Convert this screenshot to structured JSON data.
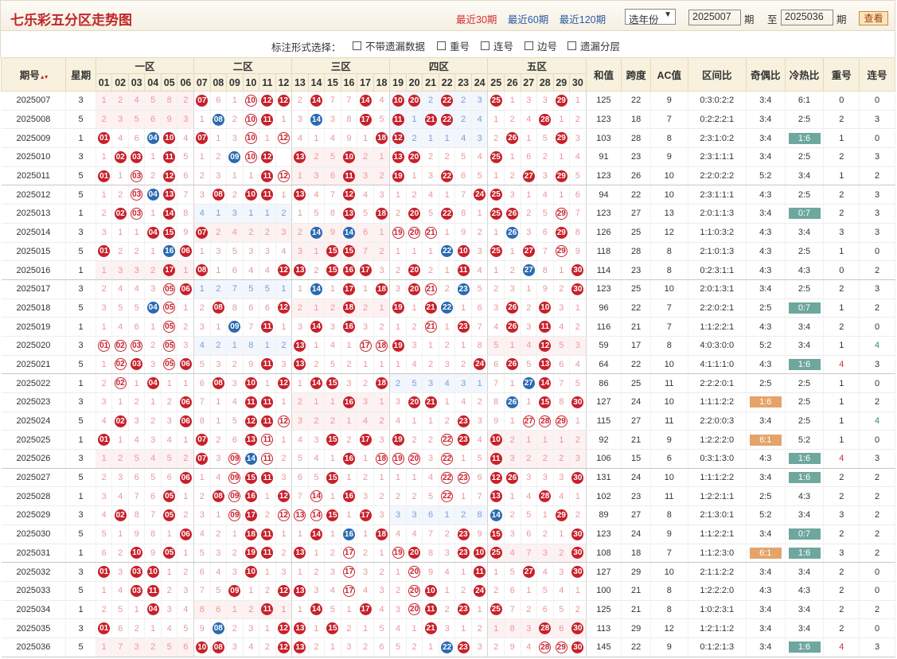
{
  "header": {
    "title": "七乐彩五分区走势图",
    "links": [
      "最近30期",
      "最近60期",
      "最近120期"
    ],
    "active_link": 0,
    "year_select": "选年份",
    "from_value": "2025007",
    "to_value": "2025036",
    "label_qi": "期",
    "label_to": "至",
    "view_button": "查看"
  },
  "options": {
    "label": "标注形式选择：",
    "items": [
      "不带遗漏数据",
      "重号",
      "连号",
      "边号",
      "遗漏分层"
    ]
  },
  "table": {
    "columns": {
      "period": "期号",
      "sort_icon": "sort-arrows-icon",
      "week": "星期",
      "zones": [
        "一区",
        "二区",
        "三区",
        "四区",
        "五区"
      ],
      "numbers": [
        "01",
        "02",
        "03",
        "04",
        "05",
        "06",
        "07",
        "08",
        "09",
        "10",
        "11",
        "12",
        "13",
        "14",
        "15",
        "16",
        "17",
        "18",
        "19",
        "20",
        "21",
        "22",
        "23",
        "24",
        "25",
        "26",
        "27",
        "28",
        "29",
        "30"
      ],
      "sum": "和值",
      "span": "跨度",
      "ac": "AC值",
      "zone_ratio": "区间比",
      "odd_even": "奇偶比",
      "hot_cold": "冷热比",
      "repeat": "重号",
      "consecutive": "连号"
    },
    "rows": [
      {
        "period": "2025007",
        "week": "3",
        "sum": "125",
        "span": "22",
        "ac": "9",
        "zone": "0:3:0:2:2",
        "oe": "3:4",
        "hc": "6:1",
        "rep": "0",
        "con": "0"
      },
      {
        "period": "2025008",
        "week": "5",
        "sum": "123",
        "span": "18",
        "ac": "7",
        "zone": "0:2:2:2:1",
        "oe": "3:4",
        "hc": "2:5",
        "rep": "2",
        "con": "3"
      },
      {
        "period": "2025009",
        "week": "1",
        "sum": "103",
        "span": "28",
        "ac": "8",
        "zone": "2:3:1:0:2",
        "oe": "3:4",
        "hc": "1:6",
        "rep": "1",
        "con": "0"
      },
      {
        "period": "2025010",
        "week": "3",
        "sum": "91",
        "span": "23",
        "ac": "9",
        "zone": "2:3:1:1:1",
        "oe": "3:4",
        "hc": "2:5",
        "rep": "2",
        "con": "3"
      },
      {
        "period": "2025011",
        "week": "5",
        "sum": "123",
        "span": "26",
        "ac": "10",
        "zone": "2:2:0:2:2",
        "oe": "5:2",
        "hc": "3:4",
        "rep": "1",
        "con": "2"
      },
      {
        "period": "2025012",
        "week": "5",
        "sum": "94",
        "span": "22",
        "ac": "10",
        "zone": "2:3:1:1:1",
        "oe": "4:3",
        "hc": "2:5",
        "rep": "2",
        "con": "3"
      },
      {
        "period": "2025013",
        "week": "1",
        "sum": "123",
        "span": "27",
        "ac": "13",
        "zone": "2:0:1:1:3",
        "oe": "3:4",
        "hc": "0:7",
        "rep": "2",
        "con": "3"
      },
      {
        "period": "2025014",
        "week": "3",
        "sum": "126",
        "span": "25",
        "ac": "12",
        "zone": "1:1:0:3:2",
        "oe": "4:3",
        "hc": "3:4",
        "rep": "3",
        "con": "3"
      },
      {
        "period": "2025015",
        "week": "5",
        "sum": "118",
        "span": "28",
        "ac": "8",
        "zone": "2:1:0:1:3",
        "oe": "4:3",
        "hc": "2:5",
        "rep": "1",
        "con": "0"
      },
      {
        "period": "2025016",
        "week": "1",
        "sum": "114",
        "span": "23",
        "ac": "8",
        "zone": "0:2:3:1:1",
        "oe": "4:3",
        "hc": "4:3",
        "rep": "0",
        "con": "2"
      },
      {
        "period": "2025017",
        "week": "3",
        "sum": "123",
        "span": "25",
        "ac": "10",
        "zone": "2:0:1:3:1",
        "oe": "3:4",
        "hc": "2:5",
        "rep": "2",
        "con": "3"
      },
      {
        "period": "2025018",
        "week": "5",
        "sum": "96",
        "span": "22",
        "ac": "7",
        "zone": "2:2:0:2:1",
        "oe": "2:5",
        "hc": "0:7",
        "rep": "1",
        "con": "2"
      },
      {
        "period": "2025019",
        "week": "1",
        "sum": "116",
        "span": "21",
        "ac": "7",
        "zone": "1:1:2:2:1",
        "oe": "4:3",
        "hc": "3:4",
        "rep": "2",
        "con": "0"
      },
      {
        "period": "2025020",
        "week": "3",
        "sum": "59",
        "span": "17",
        "ac": "8",
        "zone": "4:0:3:0:0",
        "oe": "5:2",
        "hc": "3:4",
        "rep": "1",
        "con": "4"
      },
      {
        "period": "2025021",
        "week": "5",
        "sum": "64",
        "span": "22",
        "ac": "10",
        "zone": "4:1:1:1:0",
        "oe": "4:3",
        "hc": "1:6",
        "rep": "4",
        "con": "3"
      },
      {
        "period": "2025022",
        "week": "1",
        "sum": "86",
        "span": "25",
        "ac": "11",
        "zone": "2:2:2:0:1",
        "oe": "2:5",
        "hc": "2:5",
        "rep": "1",
        "con": "0"
      },
      {
        "period": "2025023",
        "week": "3",
        "sum": "127",
        "span": "24",
        "ac": "10",
        "zone": "1:1:1:2:2",
        "oe": "1:6",
        "hc": "2:5",
        "rep": "1",
        "con": "2"
      },
      {
        "period": "2025024",
        "week": "5",
        "sum": "115",
        "span": "27",
        "ac": "11",
        "zone": "2:2:0:0:3",
        "oe": "3:4",
        "hc": "2:5",
        "rep": "1",
        "con": "4"
      },
      {
        "period": "2025025",
        "week": "1",
        "sum": "92",
        "span": "21",
        "ac": "9",
        "zone": "1:2:2:2:0",
        "oe": "6:1",
        "hc": "5:2",
        "rep": "1",
        "con": "0"
      },
      {
        "period": "2025026",
        "week": "3",
        "sum": "106",
        "span": "15",
        "ac": "6",
        "zone": "0:3:1:3:0",
        "oe": "4:3",
        "hc": "1:6",
        "rep": "4",
        "con": "3"
      },
      {
        "period": "2025027",
        "week": "5",
        "sum": "131",
        "span": "24",
        "ac": "10",
        "zone": "1:1:1:2:2",
        "oe": "3:4",
        "hc": "1:6",
        "rep": "2",
        "con": "2"
      },
      {
        "period": "2025028",
        "week": "1",
        "sum": "102",
        "span": "23",
        "ac": "11",
        "zone": "1:2:2:1:1",
        "oe": "2:5",
        "hc": "4:3",
        "rep": "2",
        "con": "2"
      },
      {
        "period": "2025029",
        "week": "3",
        "sum": "89",
        "span": "27",
        "ac": "8",
        "zone": "2:1:3:0:1",
        "oe": "5:2",
        "hc": "3:4",
        "rep": "3",
        "con": "2"
      },
      {
        "period": "2025030",
        "week": "5",
        "sum": "123",
        "span": "24",
        "ac": "9",
        "zone": "1:1:2:2:1",
        "oe": "3:4",
        "hc": "0:7",
        "rep": "2",
        "con": "2"
      },
      {
        "period": "2025031",
        "week": "1",
        "sum": "108",
        "span": "18",
        "ac": "7",
        "zone": "1:1:2:3:0",
        "oe": "6:1",
        "hc": "1:6",
        "rep": "3",
        "con": "2"
      },
      {
        "period": "2025032",
        "week": "3",
        "sum": "127",
        "span": "29",
        "ac": "10",
        "zone": "2:1:1:2:2",
        "oe": "3:4",
        "hc": "3:4",
        "rep": "2",
        "con": "0"
      },
      {
        "period": "2025033",
        "week": "5",
        "sum": "100",
        "span": "21",
        "ac": "8",
        "zone": "1:2:2:2:0",
        "oe": "4:3",
        "hc": "4:3",
        "rep": "2",
        "con": "0"
      },
      {
        "period": "2025034",
        "week": "1",
        "sum": "125",
        "span": "21",
        "ac": "8",
        "zone": "1:0:2:3:1",
        "oe": "3:4",
        "hc": "3:4",
        "rep": "2",
        "con": "2"
      },
      {
        "period": "2025035",
        "week": "3",
        "sum": "113",
        "span": "29",
        "ac": "12",
        "zone": "1:2:1:1:2",
        "oe": "3:4",
        "hc": "3:4",
        "rep": "2",
        "con": "0"
      },
      {
        "period": "2025036",
        "week": "5",
        "sum": "145",
        "span": "22",
        "ac": "9",
        "zone": "0:1:2:1:3",
        "oe": "3:4",
        "hc": "1:6",
        "rep": "4",
        "con": "3"
      }
    ],
    "zone_cells": [
      "1 2 4 5 8 2 | 07 6 1 (10) 12 12 | 2 14 7 7 14 4 | 10 20 2 22 2 3 | 25 1 3 3 29 1",
      "2 3 5 6 9 3 | 1 08 2 (10) 11 1 | 3 14 3 8 17 5 | 11 1 21 22 2 4 | 1 2 4 28 1 2",
      "01 4 6 04 10 4 | 07 1 3 (10) 1 (12) | 4 1 4 9 1 18 | 12 2 1 1 4 3 | 2 26 1 5 29 3",
      "1 02 03 1 11 5 | 1 2 09 (10) 12 | 13 2 5 10 2 1 | 13 20 2 2 5 4 | 25 1 6 2 1 4",
      "01 1 (03) 2 12 6 | 2 3 1 1 11 (12) | 1 3 6 11 3 2 | 19 1 3 22 6 5 | 1 2 27 3 29 5",
      "1 2 (03) 04 13 7 | 3 08 2 10 11 1 | 13 4 7 12 4 3 | 1 2 4 1 7 24 | 25 3 1 4 1 6",
      "2 02 (03) 1 14 8 | 4 1 3 1 1 2 | 1 5 8 13 5 18 | 2 20 5 22 8 1 | 25 26 2 5 (29) 7",
      "3 1 1 04 15 9 | 07 2 4 2 2 3 | 2 14 9 14 6 1 | (19) (20) (21) 1 9 2 | 1 26 3 6 29 8",
      "01 2 2 1 16 06 | 1 3 5 3 3 4 | 3 1 15 15 7 2 | 1 1 1 22 10 3 | 25 1 27 7 (29) 9",
      "1 3 3 2 17 1 | 08 1 6 4 4 12 | 13 2 15 16 17 3 | 2 20 2 1 11 4 | 1 2 27 8 1 30",
      "2 4 4 3 (05) 06 | 1 2 7 5 5 1 | 1 14 1 17 1 18 | 3 20 (21) 2 23 5 | 2 3 1 9 2 30",
      "3 5 5 04 (05) 1 | 2 08 8 6 6 12 | 2 1 2 18 2 1 | 19 1 21 22 1 6 | 3 26 2 10 3 1",
      "1 4 6 1 (05) 2 | 3 1 09 7 11 1 | 3 14 3 16 3 2 | 1 2 (21) 1 23 7 | 4 26 3 11 4 2",
      "(01) (02) (03) 2 (05) 3 | 4 2 1 8 1 2 | 13 1 4 1 (17) (18) | 19 3 1 2 1 8 | 5 1 4 12 5 3",
      "1 (02) 03 3 (05) 06 | 5 3 2 9 11 3 | 13 2 5 2 1 1 | 1 4 2 3 2 24 | 6 26 5 13 6 4",
      "2 (02) 1 04 1 1 | 6 08 3 10 1 12 | 1 14 15 3 2 18 | 2 5 3 4 3 1 | 7 1 27 14 7 5",
      "3 1 2 1 2 06 | 7 1 4 11 11 1 | 2 1 1 16 3 1 | 3 20 21 1 4 2 | 8 26 1 15 8 30",
      "4 02 3 2 3 06 | 8 1 5 12 11 (12) | 3 2 2 1 4 2 | 4 1 1 2 23 3 | 9 1 (27) (28) (29) 1",
      "01 1 4 3 4 1 | 07 2 6 13 (11) 1 | 4 3 15 2 17 3 | 19 2 2 (22) 23 4 | 10 2 1 1 1 2",
      "1 2 5 4 5 2 | 07 3 (09) 14 (11) 2 | 5 4 1 16 1 (18) | (19) (20) 3 (22) 1 5 | 11 3 2 2 2 3",
      "2 3 6 5 6 06 | 1 4 (09) 15 11 3 | 6 5 15 1 2 1 | 1 1 4 (22) (23) 6 | 12 26 3 3 3 30",
      "3 4 7 6 05 1 | 2 08 (09) 16 1 12 | 7 (14) 1 16 3 2 | 2 2 5 (22) 1 7 | 13 1 4 28 4 1",
      "4 02 8 7 05 2 | 3 1 (09) 17 2 (12) | (13) (14) 15 1 17 3 | 3 3 6 1 2 8 | 14 2 5 1 29 2",
      "5 1 9 8 1 06 | 4 2 1 18 11 1 | 1 14 1 16 1 18 | 4 4 7 2 23 9 | 15 3 6 2 1 30",
      "6 2 10 9 05 1 | 5 3 2 19 11 2 | 13 1 2 (17) 2 1 | (19) 20 8 3 23 10 | 25 4 7 3 2 30",
      "01 3 03 10 1 2 | 6 4 3 10 1 3 | 1 2 3 (17) 3 2 | 1 (20) 9 4 1 11 | 1 5 27 4 3 30",
      "1 4 03 11 2 3 | 7 5 09 1 2 12 | 13 3 4 (17) 4 3 | 2 (20) 10 1 2 24 | 2 6 1 5 4 1",
      "2 5 1 04 3 4 | 8 6 1 2 11 1 | 1 14 5 1 17 4 | 3 (20) 11 2 23 1 | 25 7 2 6 5 2",
      "01 6 2 1 4 5 | 9 08 2 3 1 12 | 13 1 15 2 1 5 | 4 1 21 3 1 2 | 1 8 3 28 6 30",
      "1 7 3 2 5 6 | 10 08 3 4 2 12 | 13 2 1 3 2 6 | 5 2 1 22 23 3 | 2 9 4 (28) (29) 30"
    ]
  }
}
